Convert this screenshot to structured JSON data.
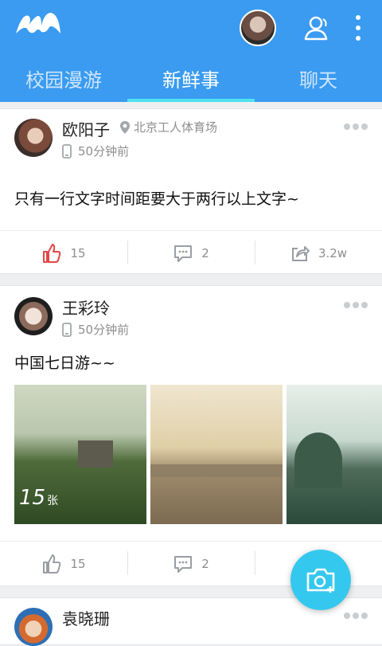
{
  "header": {
    "tabs": [
      {
        "label": "校园漫游"
      },
      {
        "label": "新鲜事"
      },
      {
        "label": "聊天"
      }
    ],
    "active_tab_index": 1,
    "accent_color": "#3a9bf0",
    "indicator_color": "#4fe0f0"
  },
  "feed": [
    {
      "name": "欧阳子",
      "location": "北京工人体育场",
      "time": "50分钟前",
      "text": "只有一行文字时间距要大于两行以上文字~",
      "likes": "15",
      "comments": "2",
      "shares": "3.2w"
    },
    {
      "name": "王彩玲",
      "time": "50分钟前",
      "text": "中国七日游~~",
      "photo_count": "15",
      "photo_count_unit": "张",
      "likes": "15",
      "comments": "2"
    },
    {
      "name": "袁晓珊"
    }
  ],
  "icons": {
    "logo": "app-logo",
    "contacts": "contacts-icon",
    "more": "more-icon",
    "location": "location-pin-icon",
    "device": "phone-icon",
    "like": "thumbs-up-icon",
    "comment": "comment-icon",
    "share": "share-icon",
    "camera": "camera-add-icon"
  }
}
